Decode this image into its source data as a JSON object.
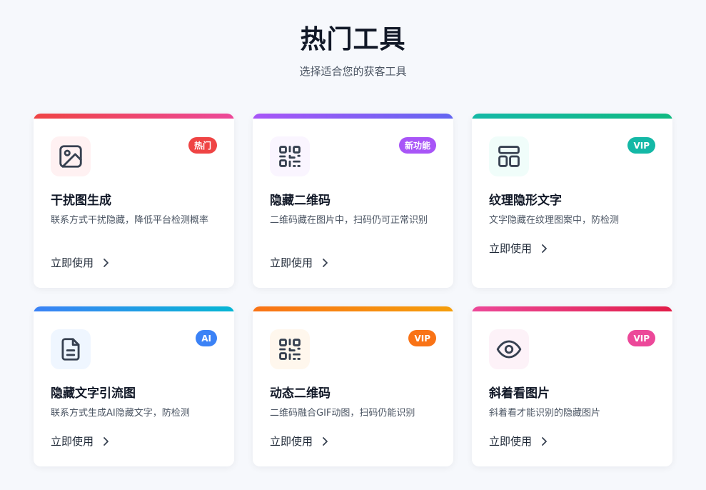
{
  "header": {
    "title": "热门工具",
    "subtitle": "选择适合您的获客工具"
  },
  "cards": [
    {
      "title": "干扰图生成",
      "desc": "联系方式干扰隐藏，降低平台检测概率",
      "badge": "热门",
      "cta": "立即使用",
      "icon": "image-icon",
      "colors": {
        "bar_from": "#ef4444",
        "bar_to": "#ec4899",
        "badge": "#ef4444",
        "icon_bg": "#fff1f2"
      }
    },
    {
      "title": "隐藏二维码",
      "desc": "二维码藏在图片中，扫码仍可正常识别",
      "badge": "新功能",
      "cta": "立即使用",
      "icon": "qr-code-icon",
      "colors": {
        "bar_from": "#a855f7",
        "bar_to": "#6366f1",
        "badge": "#a855f7",
        "icon_bg": "#faf5ff"
      }
    },
    {
      "title": "纹理隐形文字",
      "desc": "文字隐藏在纹理图案中，防检测",
      "badge": "VIP",
      "cta": "立即使用",
      "icon": "layout-icon",
      "colors": {
        "bar_from": "#14b8a6",
        "bar_to": "#10b981",
        "badge": "#14b8a6",
        "icon_bg": "#f0fdfa"
      }
    },
    {
      "title": "隐藏文字引流图",
      "desc": "联系方式生成AI隐藏文字，防检测",
      "badge": "AI",
      "cta": "立即使用",
      "icon": "document-icon",
      "colors": {
        "bar_from": "#3b82f6",
        "bar_to": "#06b6d4",
        "badge": "#3b82f6",
        "icon_bg": "#eff6ff"
      }
    },
    {
      "title": "动态二维码",
      "desc": "二维码融合GIF动图，扫码仍能识别",
      "badge": "VIP",
      "cta": "立即使用",
      "icon": "qr-code-icon",
      "colors": {
        "bar_from": "#f97316",
        "bar_to": "#f59e0b",
        "badge": "#f97316",
        "icon_bg": "#fff7ed"
      }
    },
    {
      "title": "斜着看图片",
      "desc": "斜着看才能识别的隐藏图片",
      "badge": "VIP",
      "cta": "立即使用",
      "icon": "eye-icon",
      "colors": {
        "bar_from": "#ec4899",
        "bar_to": "#e11d48",
        "badge": "#ec4899",
        "icon_bg": "#fdf2f8"
      }
    }
  ]
}
